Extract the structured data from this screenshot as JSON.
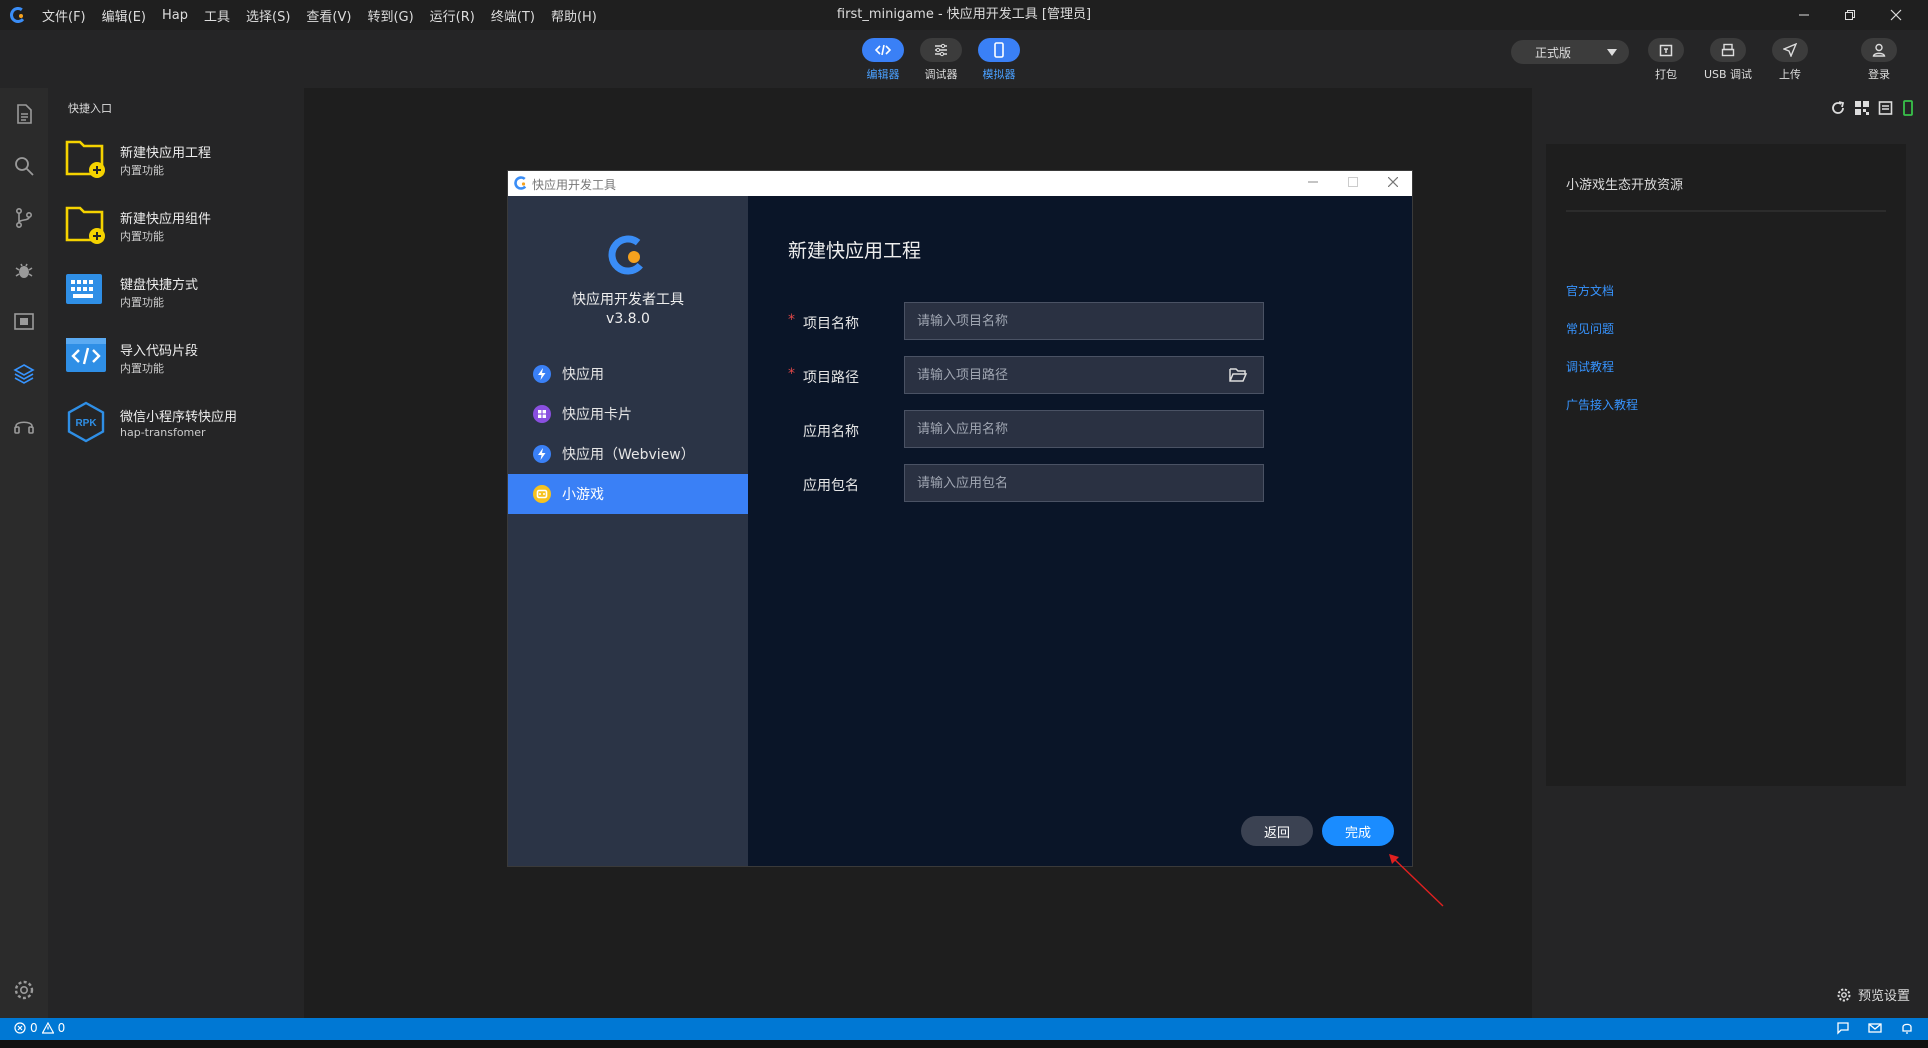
{
  "titlebar": {
    "menus": [
      "文件(F)",
      "编辑(E)",
      "Hap",
      "工具",
      "选择(S)",
      "查看(V)",
      "转到(G)",
      "运行(R)",
      "终端(T)",
      "帮助(H)"
    ],
    "window_title": "first_minigame - 快应用开发工具 [管理员]"
  },
  "toolbar": {
    "modes": [
      {
        "label": "编辑器",
        "icon": "code-icon",
        "active": true
      },
      {
        "label": "调试器",
        "icon": "sliders-icon",
        "active": false
      },
      {
        "label": "模拟器",
        "icon": "phone-icon",
        "active": true
      }
    ],
    "env_select": "正式版",
    "right_tools": [
      {
        "label": "打包",
        "icon": "package-icon"
      },
      {
        "label": "USB 调试",
        "icon": "usb-icon"
      },
      {
        "label": "上传",
        "icon": "send-icon"
      },
      {
        "label": "登录",
        "icon": "user-icon"
      }
    ]
  },
  "left_panel": {
    "title": "快捷入口",
    "items": [
      {
        "title": "新建快应用工程",
        "sub": "内置功能",
        "icon": "new-project-folder-icon"
      },
      {
        "title": "新建快应用组件",
        "sub": "内置功能",
        "icon": "new-component-folder-icon"
      },
      {
        "title": "键盘快捷方式",
        "sub": "内置功能",
        "icon": "keyboard-icon"
      },
      {
        "title": "导入代码片段",
        "sub": "内置功能",
        "icon": "code-snippet-icon"
      },
      {
        "title": "微信小程序转快应用",
        "sub": "hap-transfomer",
        "icon": "rpk-icon"
      }
    ]
  },
  "right_panel": {
    "resource_title": "小游戏生态开放资源",
    "links": [
      "官方文档",
      "常见问题",
      "调试教程",
      "广告接入教程"
    ],
    "preview_settings": "预览设置"
  },
  "statusbar": {
    "errors": "0",
    "warnings": "0"
  },
  "dialog": {
    "title": "快应用开发工具",
    "brand_name": "快应用开发者工具",
    "version": "v3.8.0",
    "nav": [
      {
        "label": "快应用",
        "icon": "lightning-icon",
        "active": false
      },
      {
        "label": "快应用卡片",
        "icon": "card-grid-icon",
        "active": false
      },
      {
        "label": "快应用（Webview）",
        "icon": "lightning-icon",
        "active": false
      },
      {
        "label": "小游戏",
        "icon": "game-icon",
        "active": true
      }
    ],
    "heading": "新建快应用工程",
    "fields": [
      {
        "label": "项目名称",
        "required": true,
        "placeholder": "请输入项目名称",
        "value": ""
      },
      {
        "label": "项目路径",
        "required": true,
        "placeholder": "请输入项目路径",
        "value": ""
      },
      {
        "label": "应用名称",
        "required": false,
        "placeholder": "请输入应用名称",
        "value": ""
      },
      {
        "label": "应用包名",
        "required": false,
        "placeholder": "请输入应用包名",
        "value": ""
      }
    ],
    "back_label": "返回",
    "finish_label": "完成"
  },
  "colors": {
    "accent": "#3a80f6",
    "finish_button": "#1a8cff",
    "statusbar": "#0078d4",
    "link": "#3794ff",
    "required": "#e04848"
  }
}
